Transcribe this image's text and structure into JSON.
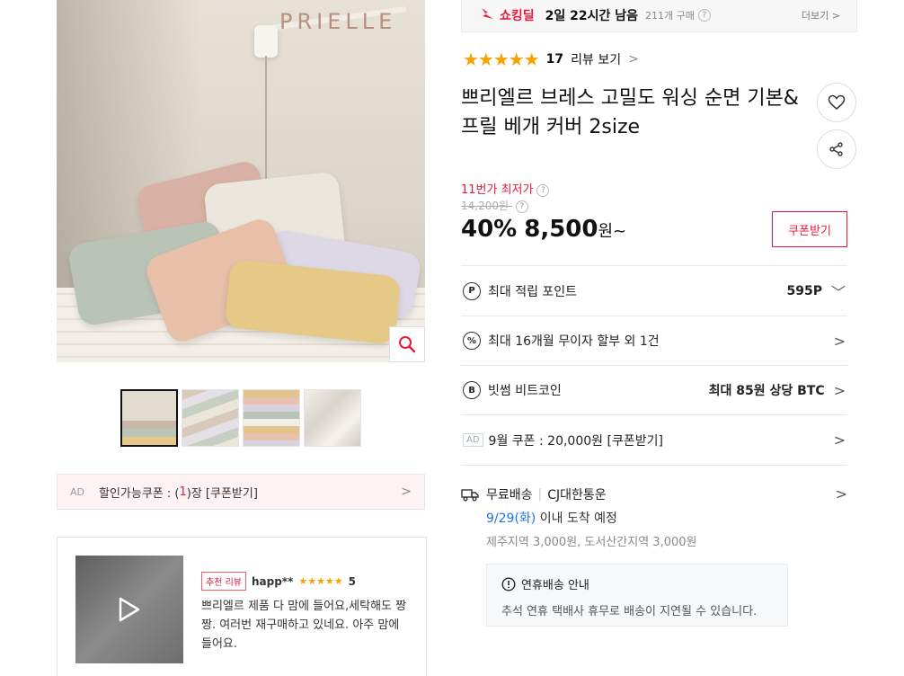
{
  "brand": "PRIELLE",
  "deal": {
    "label": "쇼킹딜",
    "time_left": "2일 22시간 남음",
    "purchase_count": "211개 구매",
    "more": "더보기 >"
  },
  "rating": {
    "stars": "★★★★★",
    "count": "17",
    "link": "리뷰 보기",
    "chevron": ">"
  },
  "product": {
    "title": "쁘리엘르 브레스 고밀도 워싱 순면 기본&프릴 베개 커버 2size"
  },
  "price": {
    "lowest_label": "11번가 최저가",
    "original": "14,200원",
    "discount": "40%",
    "value": "8,500",
    "unit": "원~",
    "coupon_button": "쿠폰받기"
  },
  "info_rows": [
    {
      "icon": "P",
      "label": "최대 적립 포인트",
      "value": "595P",
      "chevron": "﹀"
    },
    {
      "icon": "%",
      "label": "최대 16개월 무이자 할부 외 1건",
      "value": "",
      "chevron": ">"
    },
    {
      "icon": "B",
      "label": "빗썸 비트코인",
      "value": "최대 85원 상당 BTC",
      "chevron": ">"
    },
    {
      "ad": "AD",
      "label": "9월 쿠폰 : 20,000원 [쿠폰받기]",
      "chevron": ">"
    }
  ],
  "shipping": {
    "free": "무료배송",
    "carrier": "CJ대한통운",
    "date": "9/29(화)",
    "arrival": " 이내 도착 예정",
    "extra": "제주지역 3,000원, 도서산간지역 3,000원",
    "chevron": ">"
  },
  "notice": {
    "title": "연휴배송 안내",
    "text": "추석 연휴 택배사 휴무로 배송이 지연될 수 있습니다."
  },
  "coupon_ad": {
    "ad": "AD",
    "prefix": "할인가능쿠폰 : (",
    "count": "1",
    "suffix": ")장 [쿠폰받기]",
    "chevron": ">"
  },
  "review": {
    "badge": "추천 리뷰",
    "user": "happ**",
    "stars": "★★★★★",
    "score": "5",
    "text": "쁘리엘르 제품 다 맘에 들어요,세탁해도 짱짱. 여러번 재구매하고 있네요. 아주 맘에 들어요."
  },
  "colors": {
    "accent_red": "#e5193d",
    "star": "#f5a300",
    "date_blue": "#1a73e8"
  }
}
